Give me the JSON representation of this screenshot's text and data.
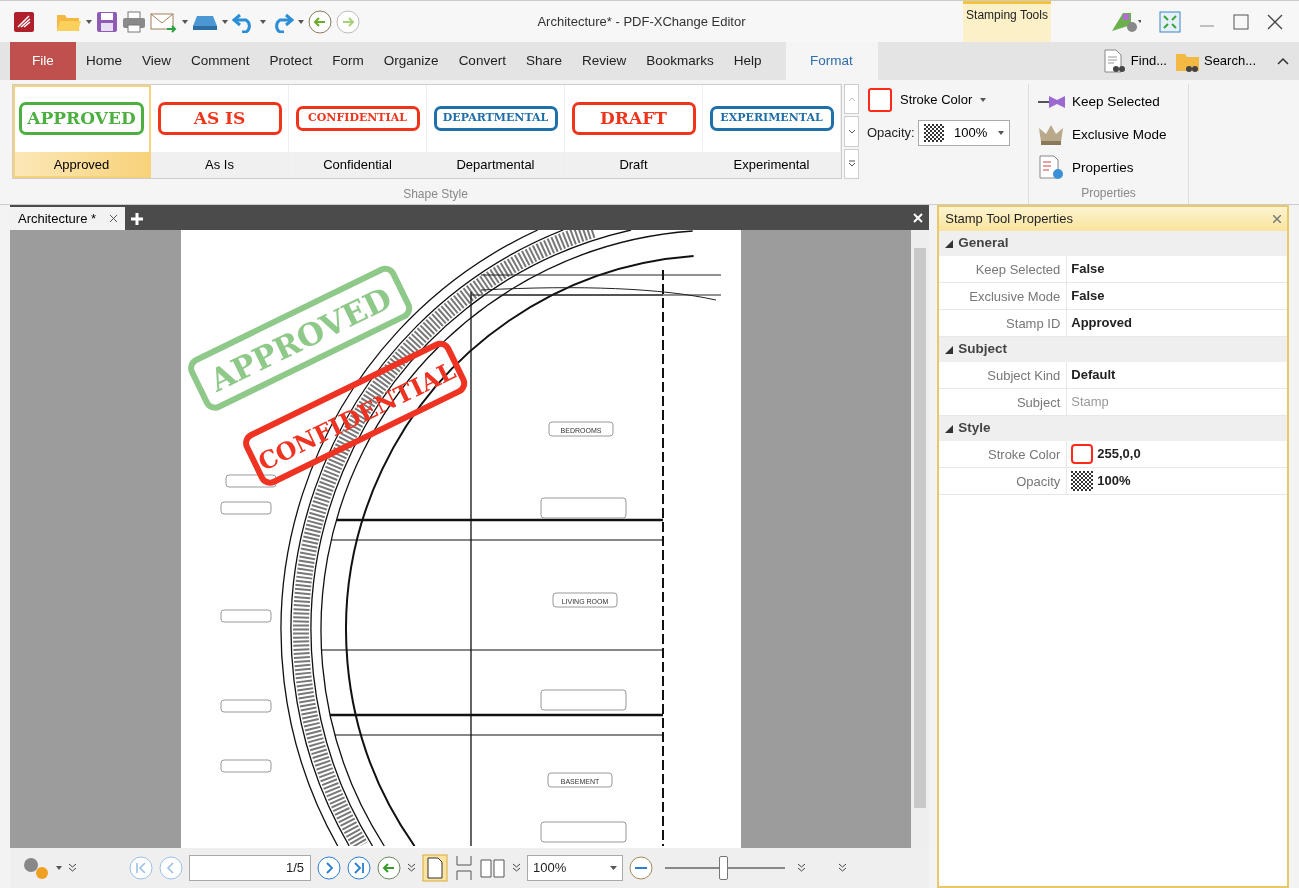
{
  "window": {
    "title": "Architecture* - PDF-XChange Editor"
  },
  "contextual_group": {
    "label": "Stamping Tools"
  },
  "menu_tabs": [
    {
      "label": "File",
      "kind": "file",
      "selected": false
    },
    {
      "label": "Home",
      "kind": "tab",
      "selected": false
    },
    {
      "label": "View",
      "kind": "tab",
      "selected": false
    },
    {
      "label": "Comment",
      "kind": "tab",
      "selected": false
    },
    {
      "label": "Protect",
      "kind": "tab",
      "selected": false
    },
    {
      "label": "Form",
      "kind": "tab",
      "selected": false
    },
    {
      "label": "Organize",
      "kind": "tab",
      "selected": false
    },
    {
      "label": "Convert",
      "kind": "tab",
      "selected": false
    },
    {
      "label": "Share",
      "kind": "tab",
      "selected": false
    },
    {
      "label": "Review",
      "kind": "tab",
      "selected": false
    },
    {
      "label": "Bookmarks",
      "kind": "tab",
      "selected": false
    },
    {
      "label": "Help",
      "kind": "tab",
      "selected": false
    },
    {
      "label": "Format",
      "kind": "tab",
      "selected": true
    }
  ],
  "menu_right": [
    {
      "label": "Find...",
      "kind": "find"
    },
    {
      "label": "Search...",
      "kind": "search"
    }
  ],
  "ribbon": {
    "stamp_gallery": {
      "group_label": "Shape Style",
      "items": [
        {
          "stamp_text": "APPROVED",
          "label": "Approved",
          "color": "#4caf3f",
          "selected": true
        },
        {
          "stamp_text": "AS IS",
          "label": "As Is",
          "color": "#f0341c",
          "selected": false
        },
        {
          "stamp_text": "CONFIDENTIAL",
          "label": "Confidential",
          "color": "#f0341c",
          "selected": false
        },
        {
          "stamp_text": "DEPARTMENTAL",
          "label": "Departmental",
          "color": "#1f6fa8",
          "selected": false
        },
        {
          "stamp_text": "DRAFT",
          "label": "Draft",
          "color": "#f0341c",
          "selected": false
        },
        {
          "stamp_text": "EXPERIMENTAL",
          "label": "Experimental",
          "color": "#1f6fa8",
          "selected": false
        }
      ]
    },
    "stroke_color": {
      "label": "Stroke Color",
      "color": "#ff2a1a"
    },
    "opacity": {
      "label": "Opacity:",
      "value": "100%"
    },
    "properties_group": {
      "group_label": "Properties",
      "items": [
        {
          "label": "Keep Selected",
          "kind": "pin"
        },
        {
          "label": "Exclusive Mode",
          "kind": "crown"
        },
        {
          "label": "Properties",
          "kind": "props"
        }
      ]
    }
  },
  "document_tab": {
    "label": "Architecture *"
  },
  "page": {
    "stamps": [
      {
        "text": "APPROVED",
        "color": "#8fc98a"
      },
      {
        "text": "CONFIDENTIAL",
        "color": "#ee3322"
      }
    ],
    "room_labels": [
      "BEDROOMS",
      "LIVING ROOM",
      "BASEMENT"
    ]
  },
  "bottom_toolbar": {
    "page_field": "1/5",
    "zoom": "100%",
    "zoom_slider": {
      "level": 0.48
    }
  },
  "properties_panel": {
    "title": "Stamp Tool Properties",
    "sections": [
      {
        "name": "General",
        "expanded": true,
        "rows": [
          {
            "name": "Keep Selected",
            "value": "False",
            "kind": "text",
            "disabled": false
          },
          {
            "name": "Exclusive Mode",
            "value": "False",
            "kind": "text",
            "disabled": false
          },
          {
            "name": "Stamp ID",
            "value": "Approved",
            "kind": "text",
            "disabled": false
          }
        ]
      },
      {
        "name": "Subject",
        "expanded": true,
        "rows": [
          {
            "name": "Subject Kind",
            "value": "Default",
            "kind": "text",
            "disabled": false
          },
          {
            "name": "Subject",
            "value": "Stamp",
            "kind": "text",
            "disabled": true
          }
        ]
      },
      {
        "name": "Style",
        "expanded": true,
        "rows": [
          {
            "name": "Stroke Color",
            "value": "255,0,0",
            "kind": "color",
            "color": "#ff2a1a",
            "disabled": false
          },
          {
            "name": "Opacity",
            "value": "100%",
            "kind": "opacity",
            "disabled": false
          }
        ]
      }
    ]
  }
}
